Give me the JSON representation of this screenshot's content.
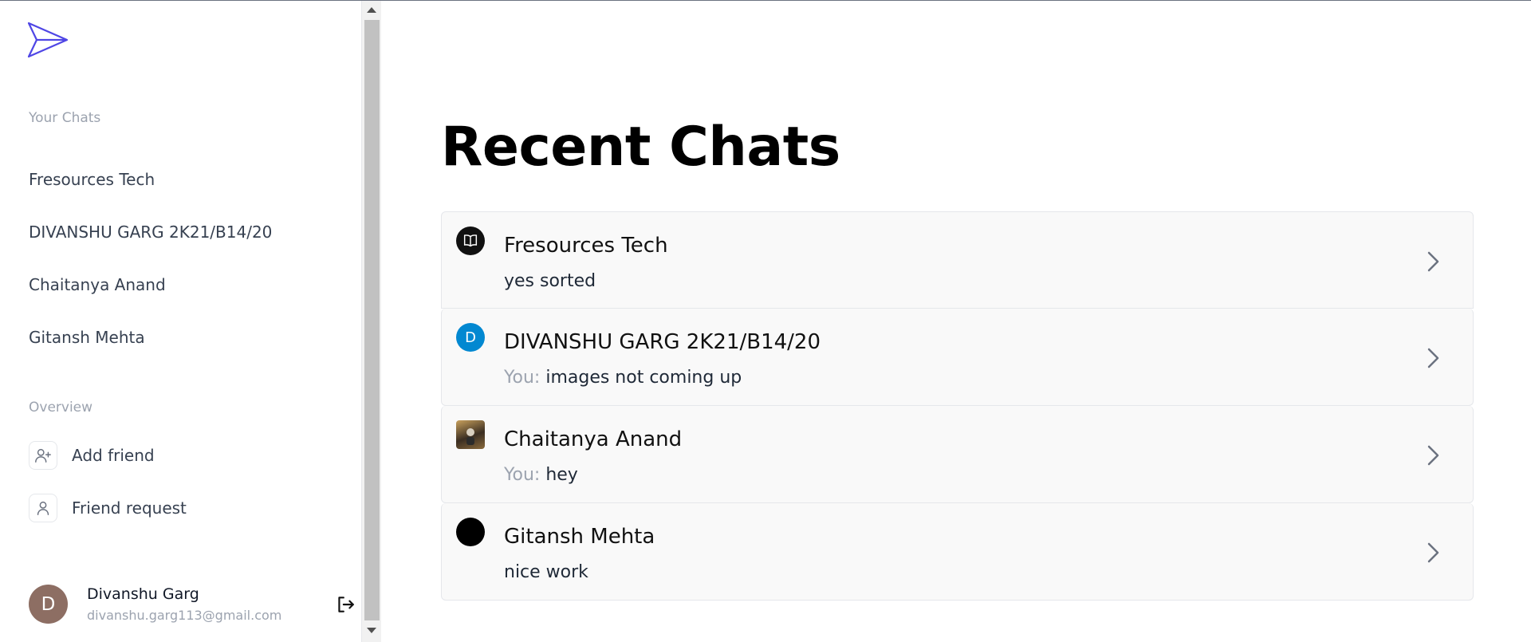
{
  "sidebar": {
    "logo_icon": "paper-plane-icon",
    "your_chats_label": "Your Chats",
    "chats": [
      "Fresources Tech",
      "DIVANSHU GARG 2K21/B14/20",
      "Chaitanya Anand",
      "Gitansh Mehta"
    ],
    "overview_label": "Overview",
    "overview_items": [
      {
        "label": "Add friend",
        "icon": "user-plus-icon"
      },
      {
        "label": "Friend request",
        "icon": "user-icon"
      }
    ],
    "user": {
      "initial": "D",
      "name": "Divanshu Garg",
      "email": "divanshu.garg113@gmail.com"
    },
    "logout_icon": "logout-icon"
  },
  "main": {
    "title": "Recent Chats",
    "chats": [
      {
        "name": "Fresources Tech",
        "you_prefix": "",
        "message": "yes sorted",
        "avatar": "book-logo"
      },
      {
        "name": "DIVANSHU GARG 2K21/B14/20",
        "you_prefix": "You: ",
        "message": "images not coming up",
        "avatar": "D"
      },
      {
        "name": "Chaitanya Anand",
        "you_prefix": "You: ",
        "message": "hey",
        "avatar": "photo"
      },
      {
        "name": "Gitansh Mehta",
        "you_prefix": "",
        "message": "nice work",
        "avatar": "black-circle"
      }
    ]
  },
  "colors": {
    "accent": "#4f46e5",
    "avatar_blue": "#0288d1",
    "avatar_brown": "#8d6e63"
  }
}
